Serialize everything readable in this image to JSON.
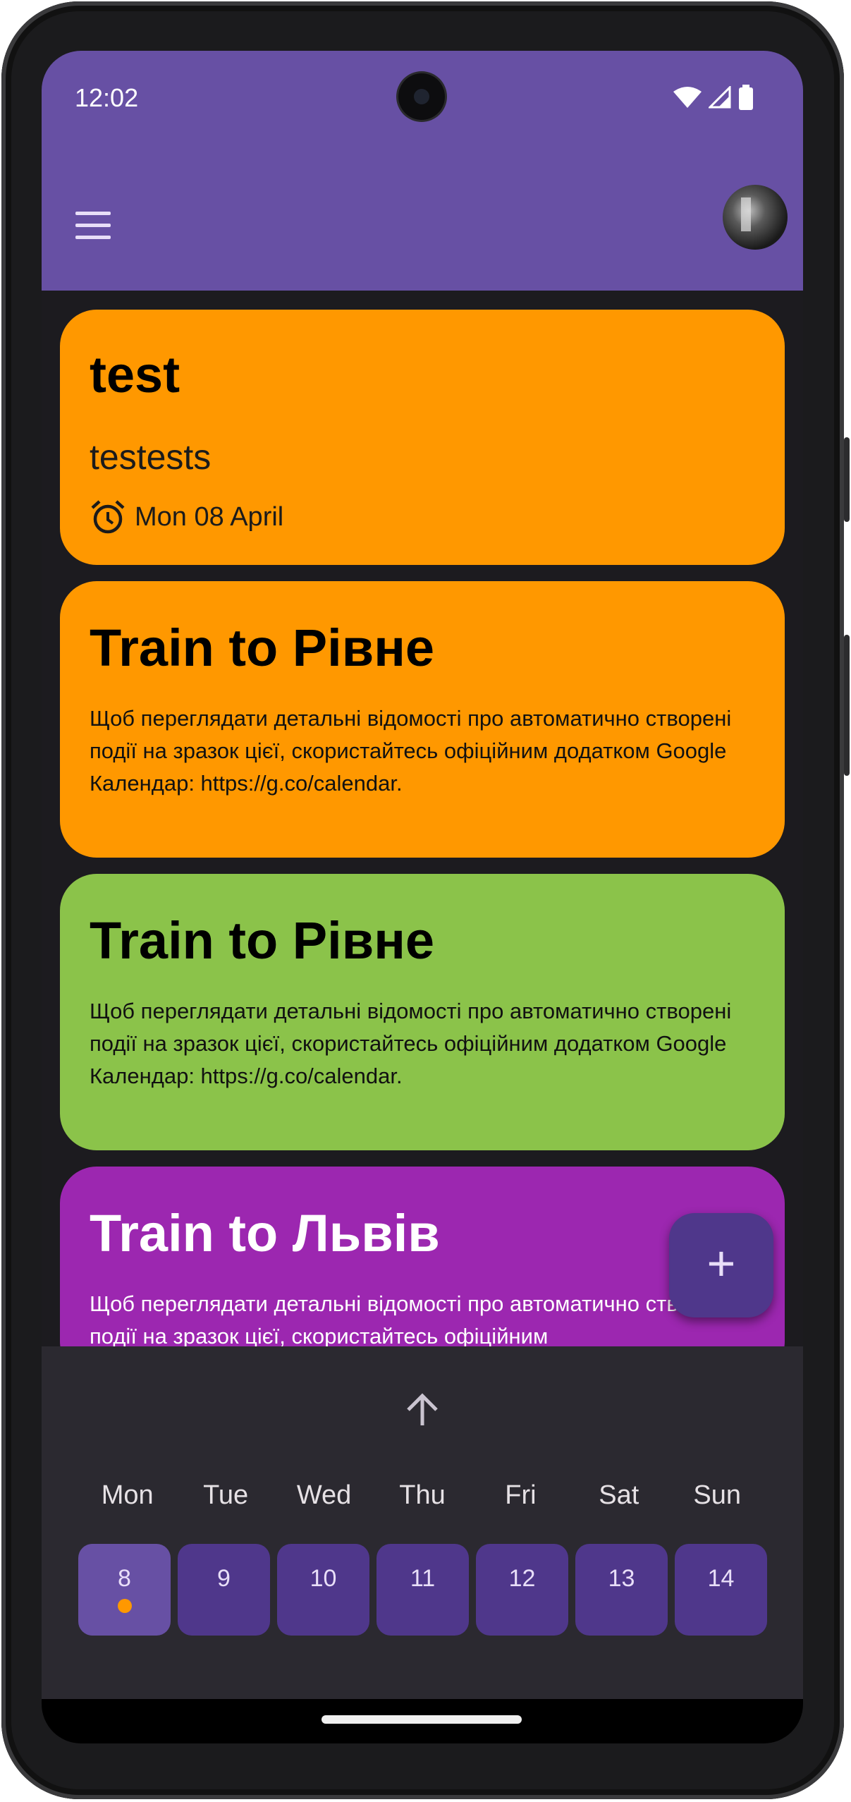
{
  "status_bar": {
    "time": "12:02"
  },
  "app_bar": {
    "menu_icon": "menu-icon",
    "avatar": "avatar"
  },
  "cards": [
    {
      "title": "test",
      "subtitle": "testests",
      "date": "Mon 08 April",
      "color": "#ff9800"
    },
    {
      "title": "Train to Рівне",
      "body": "Щоб переглядати детальні відомості про автоматично створені події на зразок цієї, скористайтесь офіційним додатком Google Календар: https://g.co/calendar.",
      "color": "#ff9800"
    },
    {
      "title": "Train to Рівне",
      "body": "Щоб переглядати детальні відомості про автоматично створені події на зразок цієї, скористайтесь офіційним додатком Google Календар: https://g.co/calendar.",
      "color": "#8bc34a"
    },
    {
      "title": "Train to Львів",
      "body": "Щоб переглядати детальні відомості про автоматично створені події на зразок цієї, скористайтесь офіційним",
      "color": "#9c27b0"
    }
  ],
  "fab": {
    "label": "+"
  },
  "week": {
    "days": [
      "Mon",
      "Tue",
      "Wed",
      "Thu",
      "Fri",
      "Sat",
      "Sun"
    ],
    "dates": [
      "8",
      "9",
      "10",
      "11",
      "12",
      "13",
      "14"
    ],
    "selected_index": 0
  },
  "colors": {
    "primary": "#6750a4",
    "chip": "#4f378b",
    "panel": "#2b2930",
    "background": "#1c1b1f"
  }
}
